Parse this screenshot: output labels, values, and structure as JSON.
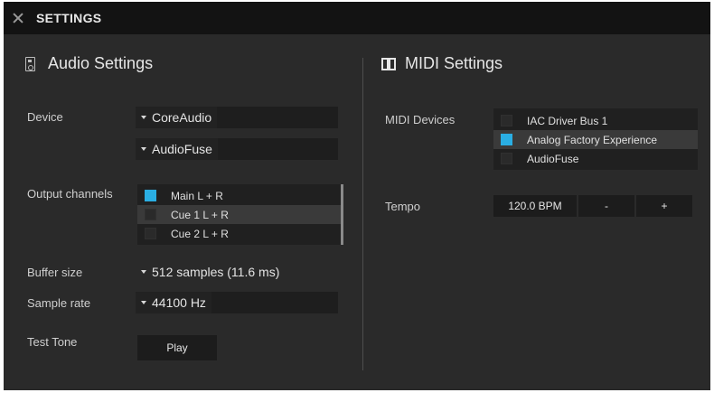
{
  "titlebar": {
    "title": "SETTINGS",
    "close_icon": "close-icon"
  },
  "audio": {
    "heading": "Audio Settings",
    "icon": "speaker-icon",
    "device_label": "Device",
    "device_driver": "CoreAudio",
    "device_name": "AudioFuse",
    "output_label": "Output channels",
    "output_channels": [
      {
        "label": "Main L + R",
        "checked": true
      },
      {
        "label": "Cue 1 L + R",
        "checked": false
      },
      {
        "label": "Cue 2 L + R",
        "checked": false
      }
    ],
    "buffer_label": "Buffer size",
    "buffer_value": "512 samples (11.6 ms)",
    "rate_label": "Sample rate",
    "rate_value": "44100 Hz",
    "tone_label": "Test Tone",
    "tone_button": "Play"
  },
  "midi": {
    "heading": "MIDI Settings",
    "icon": "keyboard-icon",
    "devices_label": "MIDI Devices",
    "devices": [
      {
        "label": "IAC Driver Bus 1",
        "checked": false
      },
      {
        "label": "Analog Factory Experience",
        "checked": true
      },
      {
        "label": "AudioFuse",
        "checked": false
      }
    ],
    "tempo_label": "Tempo",
    "tempo_value": "120.0 BPM",
    "tempo_minus": "-",
    "tempo_plus": "+"
  },
  "colors": {
    "accent": "#2aaee3",
    "background": "#2a2a2a",
    "titlebar": "#131313"
  }
}
